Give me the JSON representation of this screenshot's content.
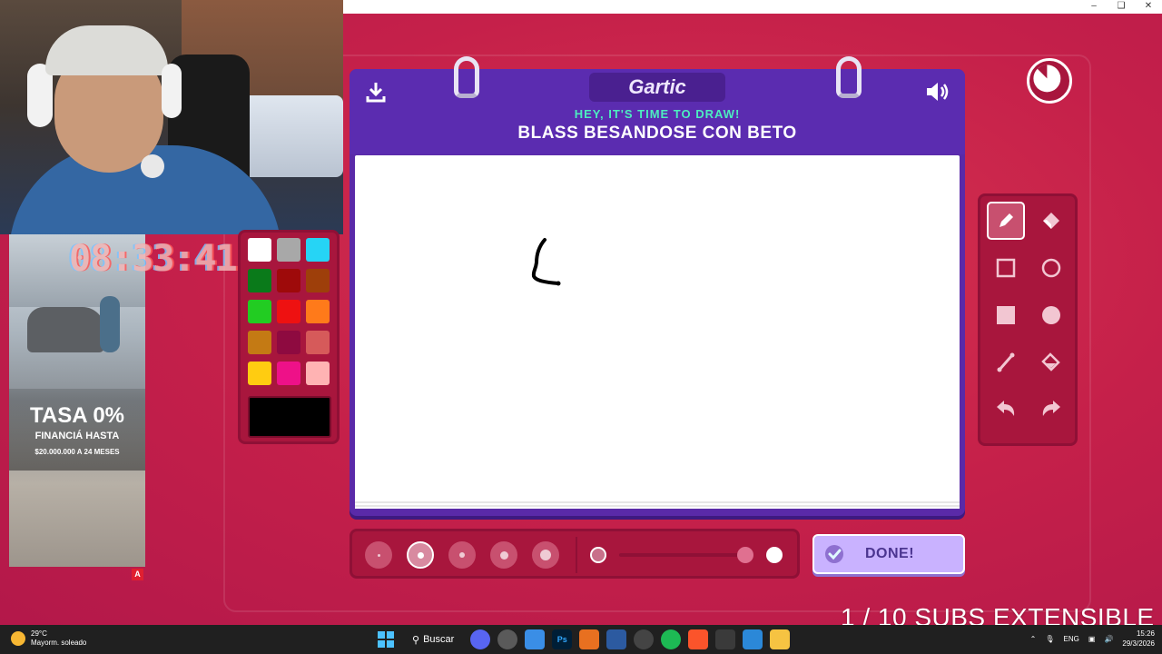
{
  "game": {
    "logo": "Gartic",
    "prompt": "HEY, IT'S TIME TO DRAW!",
    "word": "BLASS BESANDOSE CON BETO",
    "done_label": "DONE!",
    "palette": [
      "#ffffff",
      "#a8a8a8",
      "#26d4f5",
      "#0a7a1a",
      "#9e0a0a",
      "#9e3f0a",
      "#22cc22",
      "#ee1111",
      "#ff7a1a",
      "#c47a14",
      "#8e0a40",
      "#d65a5a",
      "#ffcc11",
      "#ee1188",
      "#ffb3b3"
    ],
    "current_color": "#000000",
    "tools": [
      "pencil-icon",
      "eraser-icon",
      "rectangle-outline-icon",
      "ellipse-outline-icon",
      "rectangle-filled-icon",
      "ellipse-filled-icon",
      "line-icon",
      "fill-bucket-icon",
      "undo-icon",
      "redo-icon"
    ]
  },
  "overlay": {
    "timer_text": "08:33:41",
    "subs_text": "1 / 10 SUBS EXTENSIBLE"
  },
  "ad": {
    "title": "TASA 0%",
    "subtitle": "FINANCIÁ HASTA",
    "detail": "$20.000.000 A 24 MESES",
    "badge": "A"
  },
  "taskbar": {
    "temperature": "29°C",
    "weather": "Mayorm. soleado",
    "search_label": "Buscar",
    "language": "ENG",
    "time": "15:26",
    "date": "29/3/2026"
  },
  "colors": {
    "background": "#c5204a",
    "notebook": "#5b2cb0",
    "prompt": "#4dedc0",
    "done_button": "#c9b2ff"
  }
}
